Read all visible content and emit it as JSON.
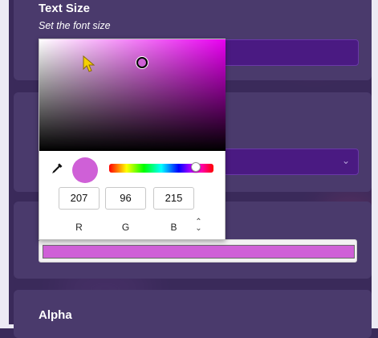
{
  "colors": {
    "page_bg": "#3a2a5a",
    "card_bg": "#4a3a6c",
    "input_purple": "#4a1a82",
    "hue_color": "#e800f0",
    "selected_color": "#cf60d7"
  },
  "text_size": {
    "title": "Text Size",
    "subtitle": "Set the font size"
  },
  "alpha": {
    "title": "Alpha"
  },
  "color_picker": {
    "hue_fraction": 0.83,
    "saturation": 0.55,
    "brightness": 0.84,
    "rgb": {
      "r": "207",
      "g": "96",
      "b": "215"
    },
    "labels": {
      "r": "R",
      "g": "G",
      "b": "B"
    },
    "icons": {
      "eyedropper": "eyedropper-icon",
      "mode_toggle": "chevron-updown-icon",
      "select": "chevron-down-icon"
    }
  }
}
